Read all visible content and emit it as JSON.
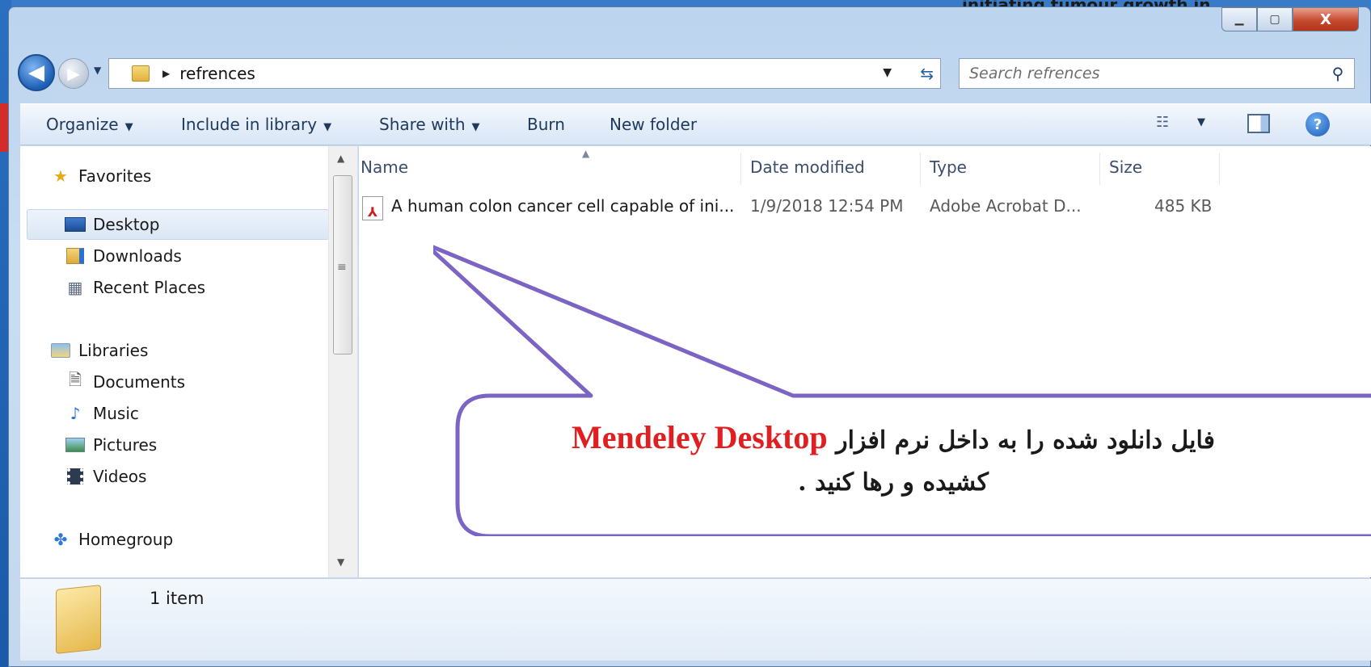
{
  "background": {
    "partial_title": "initiating tumour growth in"
  },
  "window": {
    "caption": {
      "minimize": "▁",
      "maximize": "▢",
      "close": "X"
    }
  },
  "nav": {
    "path": "refrences",
    "search_placeholder": "Search refrences"
  },
  "toolbar": {
    "organize": "Organize",
    "include_in_library": "Include in library",
    "share_with": "Share with",
    "burn": "Burn",
    "new_folder": "New folder"
  },
  "sidebar": {
    "items": [
      {
        "label": "Favorites",
        "icon": "star-icon"
      },
      {
        "label": "Desktop",
        "icon": "desktop-icon"
      },
      {
        "label": "Downloads",
        "icon": "downloads-folder-icon"
      },
      {
        "label": "Recent Places",
        "icon": "recent-places-icon"
      },
      {
        "label": "Libraries",
        "icon": "libraries-icon"
      },
      {
        "label": "Documents",
        "icon": "document-icon"
      },
      {
        "label": "Music",
        "icon": "music-icon"
      },
      {
        "label": "Pictures",
        "icon": "pictures-icon"
      },
      {
        "label": "Videos",
        "icon": "videos-icon"
      },
      {
        "label": "Homegroup",
        "icon": "homegroup-icon"
      }
    ]
  },
  "columns": {
    "name": "Name",
    "date_modified": "Date modified",
    "type": "Type",
    "size": "Size"
  },
  "files": [
    {
      "name": "A human colon cancer cell capable of ini...",
      "date_modified": "1/9/2018 12:54 PM",
      "type": "Adobe Acrobat D...",
      "size": "485 KB"
    }
  ],
  "status": {
    "item_count": "1 item"
  },
  "callout": {
    "line1_prefix": "فایل دانلود شده را به داخل نرم افزار",
    "highlight": "Mendeley Desktop",
    "line2": "کشیده و رها کنید .",
    "border_color": "#7b64c4",
    "highlight_color": "#e02020"
  }
}
